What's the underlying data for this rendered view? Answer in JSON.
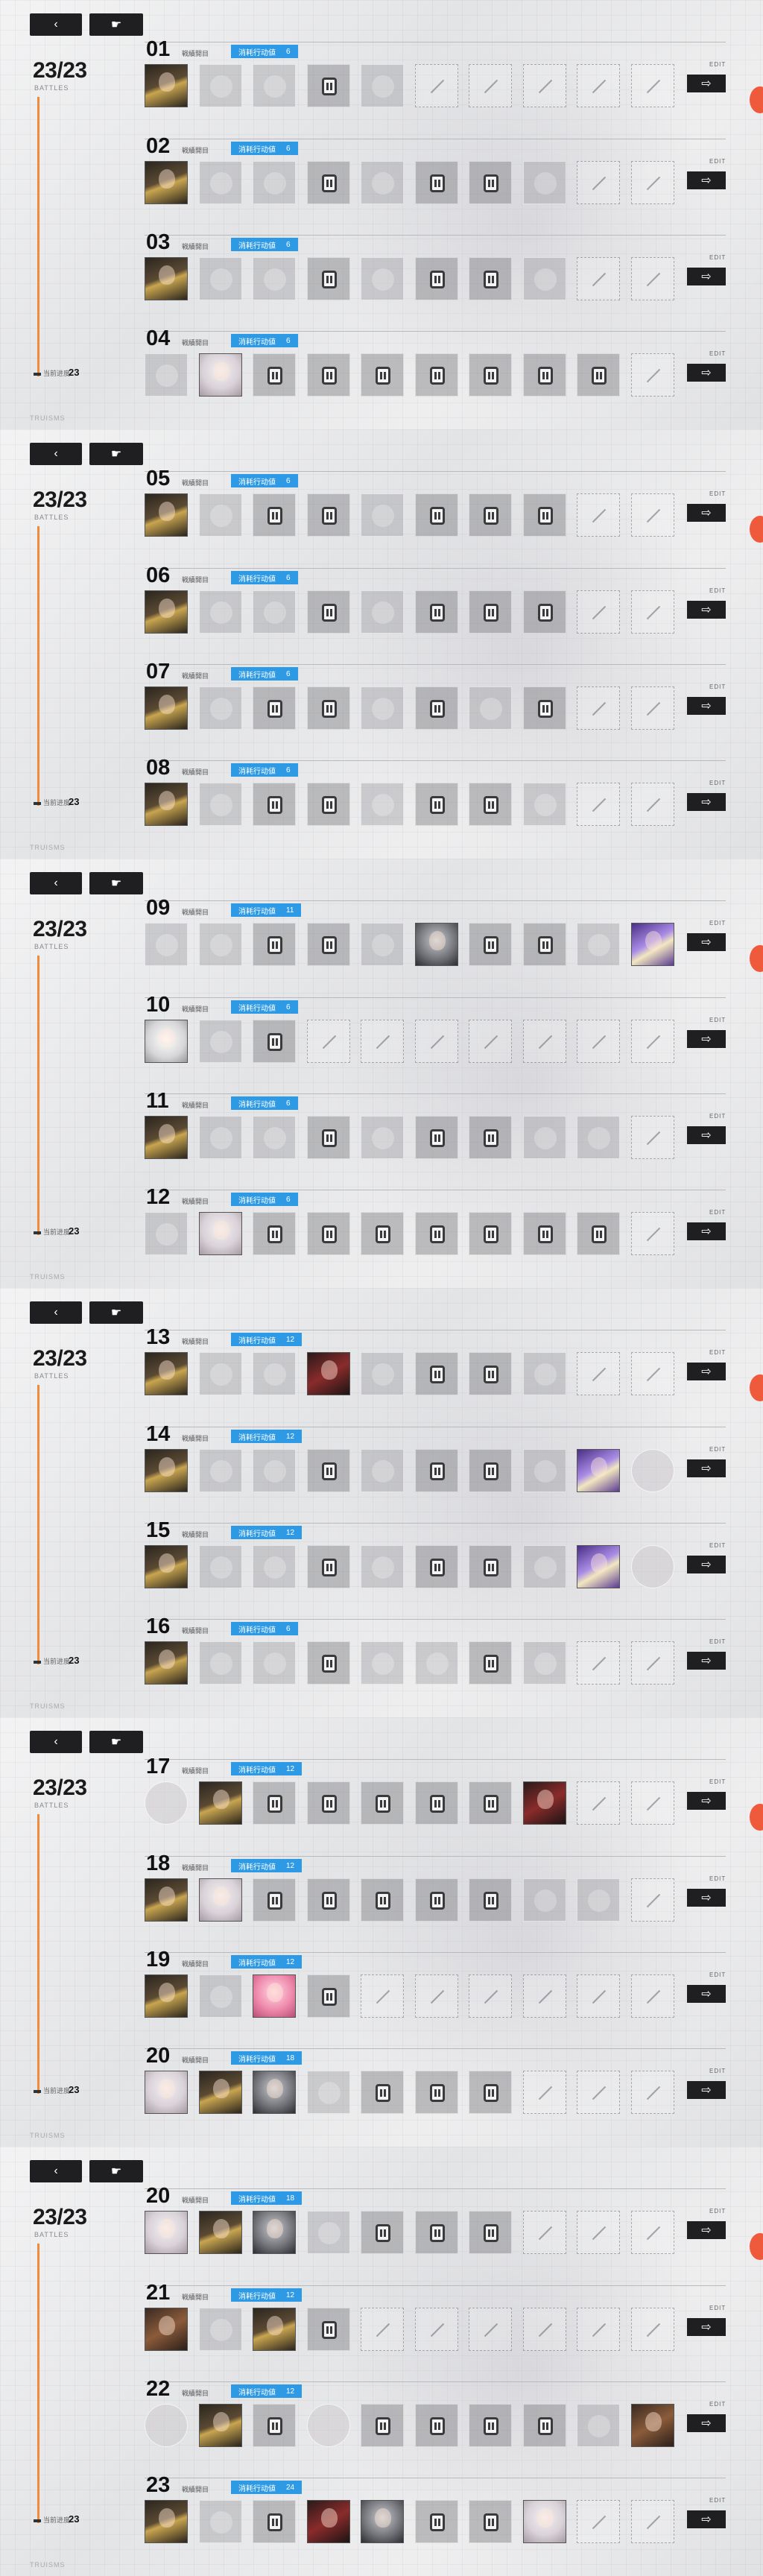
{
  "nav": {
    "back_icon": "‹",
    "home_icon": "☛"
  },
  "counter": "23/23",
  "counter_sub": "BATTLES",
  "progress_label": "当前进度",
  "progress_value": "23",
  "bottom_code": "TRUISMS",
  "tag_text": "戦績開目",
  "cost_label": "消耗行动値",
  "edit_text": "EDIT",
  "go_icon": "⇨",
  "panels": [
    {
      "rows": [
        {
          "num": "01",
          "cost": "6",
          "cells": [
            "char:gold",
            "faded",
            "faded",
            "dev",
            "faded",
            "empty",
            "empty",
            "empty",
            "empty",
            "empty"
          ]
        },
        {
          "num": "02",
          "cost": "6",
          "cells": [
            "char:gold",
            "faded",
            "faded",
            "dev",
            "faded",
            "dev",
            "dev",
            "faded",
            "empty",
            "empty"
          ]
        },
        {
          "num": "03",
          "cost": "6",
          "cells": [
            "char:gold",
            "faded",
            "faded",
            "dev",
            "faded",
            "dev",
            "dev",
            "faded",
            "empty",
            "empty"
          ]
        },
        {
          "num": "04",
          "cost": "6",
          "cells": [
            "faded",
            "char:white",
            "dev",
            "dev",
            "dev",
            "dev",
            "dev",
            "dev",
            "dev",
            "empty"
          ]
        }
      ]
    },
    {
      "rows": [
        {
          "num": "05",
          "cost": "6",
          "cells": [
            "char:gold",
            "faded",
            "dev",
            "dev",
            "faded",
            "dev",
            "dev",
            "dev",
            "empty",
            "empty"
          ]
        },
        {
          "num": "06",
          "cost": "6",
          "cells": [
            "char:gold",
            "faded",
            "faded",
            "dev",
            "faded",
            "dev",
            "dev",
            "dev",
            "empty",
            "empty"
          ]
        },
        {
          "num": "07",
          "cost": "6",
          "cells": [
            "char:gold",
            "faded",
            "dev",
            "dev",
            "faded",
            "dev",
            "faded",
            "dev",
            "empty",
            "empty"
          ]
        },
        {
          "num": "08",
          "cost": "6",
          "cells": [
            "char:gold",
            "faded",
            "dev",
            "dev",
            "faded",
            "dev",
            "dev",
            "faded",
            "empty",
            "empty"
          ]
        }
      ]
    },
    {
      "rows": [
        {
          "num": "09",
          "cost": "11",
          "cells": [
            "faded",
            "faded",
            "dev",
            "dev",
            "faded",
            "char:grey",
            "dev",
            "dev",
            "faded",
            "char:purple"
          ]
        },
        {
          "num": "10",
          "cost": "6",
          "cells": [
            "char:sketch",
            "faded",
            "dev",
            "empty",
            "empty",
            "empty",
            "empty",
            "empty",
            "empty",
            "empty"
          ]
        },
        {
          "num": "11",
          "cost": "6",
          "cells": [
            "char:gold",
            "faded",
            "faded",
            "dev",
            "faded",
            "dev",
            "dev",
            "faded",
            "faded",
            "empty"
          ]
        },
        {
          "num": "12",
          "cost": "6",
          "cells": [
            "faded",
            "char:white",
            "dev",
            "dev",
            "dev",
            "dev",
            "dev",
            "dev",
            "dev",
            "empty"
          ]
        }
      ]
    },
    {
      "rows": [
        {
          "num": "13",
          "cost": "12",
          "cells": [
            "char:gold",
            "faded",
            "faded",
            "char:red",
            "faded",
            "dev",
            "dev",
            "faded",
            "empty",
            "empty"
          ]
        },
        {
          "num": "14",
          "cost": "12",
          "cells": [
            "char:gold",
            "faded",
            "faded",
            "dev",
            "faded",
            "dev",
            "dev",
            "faded",
            "char:purple",
            "round"
          ]
        },
        {
          "num": "15",
          "cost": "12",
          "cells": [
            "char:gold",
            "faded",
            "faded",
            "dev",
            "faded",
            "dev",
            "dev",
            "faded",
            "char:purple",
            "round"
          ]
        },
        {
          "num": "16",
          "cost": "6",
          "cells": [
            "char:gold",
            "faded",
            "faded",
            "dev",
            "faded",
            "faded",
            "dev",
            "faded",
            "empty",
            "empty"
          ]
        }
      ]
    },
    {
      "rows": [
        {
          "num": "17",
          "cost": "12",
          "cells": [
            "round",
            "char:gold",
            "dev",
            "dev",
            "dev",
            "dev",
            "dev",
            "char:red",
            "empty",
            "empty"
          ]
        },
        {
          "num": "18",
          "cost": "12",
          "cells": [
            "char:gold",
            "char:white",
            "dev",
            "dev",
            "dev",
            "dev",
            "dev",
            "faded",
            "faded",
            "empty"
          ]
        },
        {
          "num": "19",
          "cost": "12",
          "cells": [
            "char:gold",
            "faded",
            "char:pink",
            "dev",
            "empty",
            "empty",
            "empty",
            "empty",
            "empty",
            "empty"
          ]
        },
        {
          "num": "20",
          "cost": "18",
          "cells": [
            "char:white",
            "char:gold",
            "char:grey",
            "faded",
            "dev",
            "dev",
            "dev",
            "empty",
            "empty",
            "empty"
          ]
        }
      ]
    },
    {
      "rows": [
        {
          "num": "20",
          "cost": "18",
          "cells": [
            "char:white",
            "char:gold",
            "char:grey",
            "faded",
            "dev",
            "dev",
            "dev",
            "empty",
            "empty",
            "empty"
          ]
        },
        {
          "num": "21",
          "cost": "12",
          "cells": [
            "char:brown",
            "faded",
            "char:gold",
            "dev",
            "empty",
            "empty",
            "empty",
            "empty",
            "empty",
            "empty"
          ]
        },
        {
          "num": "22",
          "cost": "12",
          "cells": [
            "round",
            "char:gold",
            "dev",
            "round",
            "dev",
            "dev",
            "dev",
            "dev",
            "faded",
            "char:brown"
          ]
        },
        {
          "num": "23",
          "cost": "24",
          "cells": [
            "char:gold",
            "faded",
            "dev",
            "char:red",
            "char:grey",
            "dev",
            "dev",
            "char:white",
            "empty",
            "empty"
          ]
        }
      ]
    }
  ]
}
